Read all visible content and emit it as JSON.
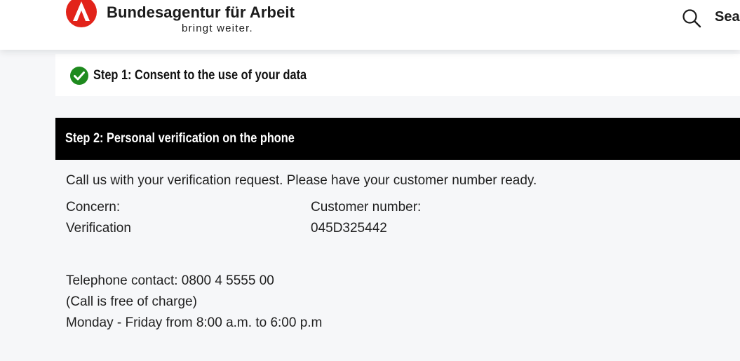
{
  "header": {
    "brand_name": "Bundesagentur für Arbeit",
    "brand_tagline": "bringt weiter.",
    "search_label": "Sea",
    "brand_color": "#e2231a",
    "logo_icon": "ba-logo-icon",
    "search_icon": "search-icon"
  },
  "step1": {
    "label": "Step 1: Consent to the use of your data",
    "status": "completed",
    "status_icon": "check-circle-icon",
    "status_color": "#1e8a1e"
  },
  "step2": {
    "label": "Step 2: Personal verification on the phone",
    "intro": "Call us with your verification request. Please have your customer number ready.",
    "concern_label": "Concern:",
    "concern_value": "Verification",
    "customer_number_label": "Customer number:",
    "customer_number_value": "045D325442",
    "telephone_line": "Telephone contact: 0800 4 5555 00",
    "free_note": "(Call is free of charge)",
    "hours": "Monday - Friday from 8:00 a.m. to 6:00 p.m"
  }
}
